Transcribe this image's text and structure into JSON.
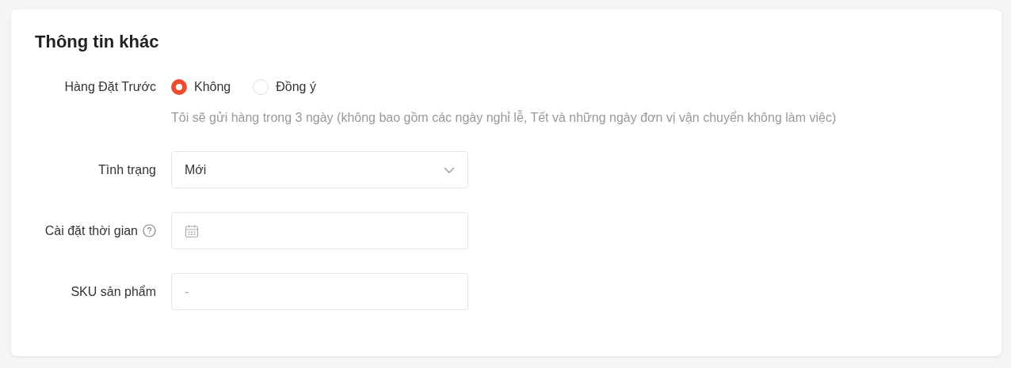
{
  "title": "Thông tin khác",
  "fields": [
    {
      "kind": "radio",
      "label": "Hàng Đặt Trước",
      "options": [
        {
          "label": "Không",
          "selected": true
        },
        {
          "label": "Đồng ý",
          "selected": false
        }
      ],
      "hint": "Tôi sẽ gửi hàng trong 3 ngày (không bao gồm các ngày nghỉ lễ, Tết và những ngày đơn vị vận chuyển không làm việc)"
    },
    {
      "kind": "select",
      "label": "Tình trạng",
      "value": "Mới"
    },
    {
      "kind": "date",
      "label": "Cài đặt thời gian",
      "help": true
    },
    {
      "kind": "text",
      "label": "SKU sản phẩm",
      "placeholder": "-"
    }
  ]
}
